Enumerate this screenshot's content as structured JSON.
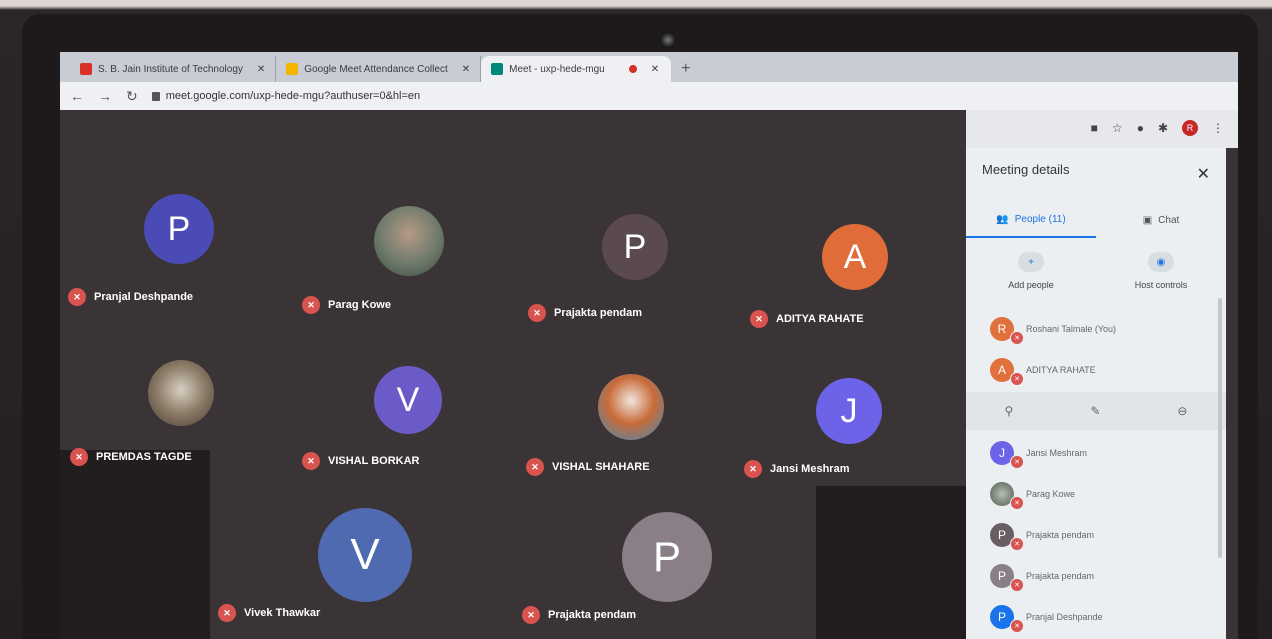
{
  "browser": {
    "tabs": [
      {
        "label": "S. B. Jain Institute of Technology",
        "icon": "gmail-icon",
        "color": "#d93025"
      },
      {
        "label": "Google Meet Attendance Collect",
        "icon": "extension-icon",
        "color": "#f4b400"
      },
      {
        "label": "Meet - uxp-hede-mgu",
        "icon": "meet-icon",
        "color": "#00897b"
      }
    ],
    "close_glyph": "✕",
    "new_tab_glyph": "+",
    "url": "meet.google.com/uxp-hede-mgu?authuser=0&hl=en"
  },
  "meet": {
    "tiles": [
      {
        "name": "Pranjal Deshpande",
        "initial": "P",
        "color": "#4a4bb5"
      },
      {
        "name": "Parag Kowe",
        "initial": "",
        "color": "#6d7a6b"
      },
      {
        "name": "Prajakta pendam",
        "initial": "P",
        "color": "#5a4a4e"
      },
      {
        "name": "ADITYA RAHATE",
        "initial": "A",
        "color": "#e06c3a"
      },
      {
        "name": "PREMDAS TAGDE",
        "initial": "",
        "color": "#8a7a66"
      },
      {
        "name": "VISHAL BORKAR",
        "initial": "V",
        "color": "#6a5bc9"
      },
      {
        "name": "VISHAL SHAHARE",
        "initial": "",
        "color": "#c96b3a"
      },
      {
        "name": "Jansi Meshram",
        "initial": "J",
        "color": "#6c63e8"
      },
      {
        "name": "Vivek Thawkar",
        "initial": "V",
        "color": "#4f6ab0"
      },
      {
        "name": "Prajakta pendam",
        "initial": "P",
        "color": "#8a7f86"
      }
    ]
  },
  "panel": {
    "title": "Meeting details",
    "close": "✕",
    "people_tab": "People (11)",
    "chat_tab": "Chat",
    "add_people": "Add people",
    "host_controls": "Host controls",
    "participants_top": [
      {
        "name": "Roshani Talmale (You)",
        "initial": "R",
        "color": "#e0703c"
      },
      {
        "name": "ADITYA RAHATE",
        "initial": "A",
        "color": "#e0703c"
      }
    ],
    "participants": [
      {
        "name": "Jansi Meshram",
        "initial": "J",
        "color": "#6c63e8"
      },
      {
        "name": "Parag Kowe",
        "initial": "",
        "color": "#6d7a6b"
      },
      {
        "name": "Prajakta pendam",
        "initial": "P",
        "color": "#6b5e63"
      },
      {
        "name": "Prajakta pendam",
        "initial": "P",
        "color": "#8a7f86"
      },
      {
        "name": "Pranjal Deshpande",
        "initial": "P",
        "color": "#1a73e8"
      }
    ]
  }
}
